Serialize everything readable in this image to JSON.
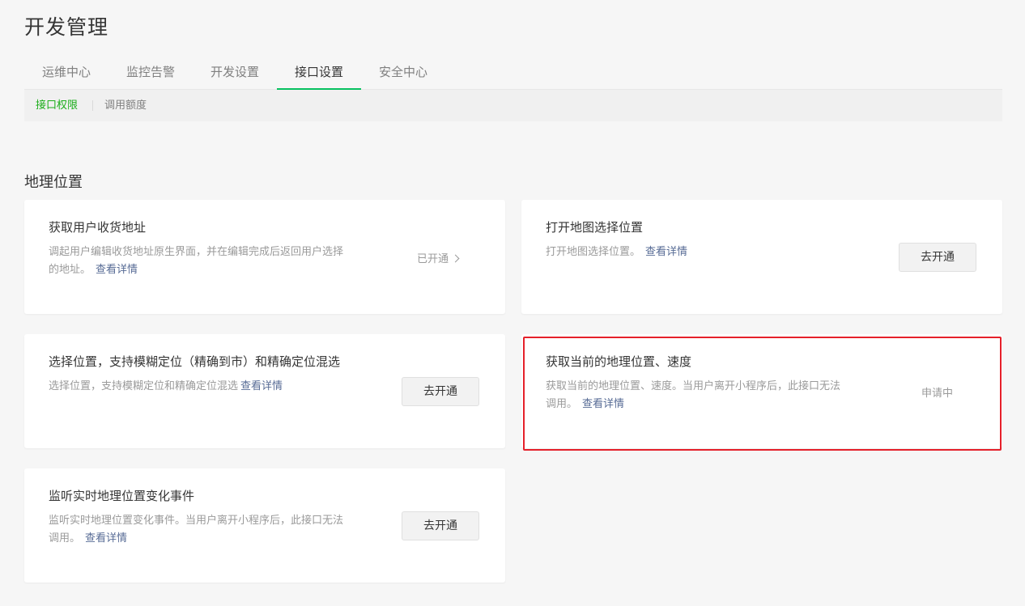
{
  "page": {
    "title": "开发管理"
  },
  "tabs": [
    {
      "label": "运维中心"
    },
    {
      "label": "监控告警"
    },
    {
      "label": "开发设置"
    },
    {
      "label": "接口设置"
    },
    {
      "label": "安全中心"
    }
  ],
  "subnav": [
    {
      "label": "接口权限"
    },
    {
      "label": "调用额度"
    }
  ],
  "section": {
    "title": "地理位置"
  },
  "cards": [
    {
      "title": "获取用户收货地址",
      "desc_line1": "调起用户编辑收货地址原生界面，并在编辑完成后返回用户选择",
      "desc_line2": "的地址。",
      "link": "查看详情",
      "status": "已开通"
    },
    {
      "title": "打开地图选择位置",
      "desc_line1": "打开地图选择位置。",
      "link": "查看详情",
      "action": "去开通"
    },
    {
      "title": "选择位置，支持模糊定位（精确到市）和精确定位混选",
      "desc_line1": "选择位置，支持模糊定位和精确定位混选",
      "link": "查看详情",
      "action": "去开通"
    },
    {
      "title": "获取当前的地理位置、速度",
      "desc_line1": "获取当前的地理位置、速度。当用户离开小程序后，此接口无法",
      "desc_line2": "调用。",
      "link": "查看详情",
      "status": "申请中"
    },
    {
      "title": "监听实时地理位置变化事件",
      "desc_line1": "监听实时地理位置变化事件。当用户离开小程序后，此接口无法",
      "desc_line2": "调用。",
      "link": "查看详情",
      "action": "去开通"
    }
  ],
  "colors": {
    "accent_green": "#07c160",
    "link_blue": "#576b95",
    "highlight_red": "#e5202a"
  }
}
